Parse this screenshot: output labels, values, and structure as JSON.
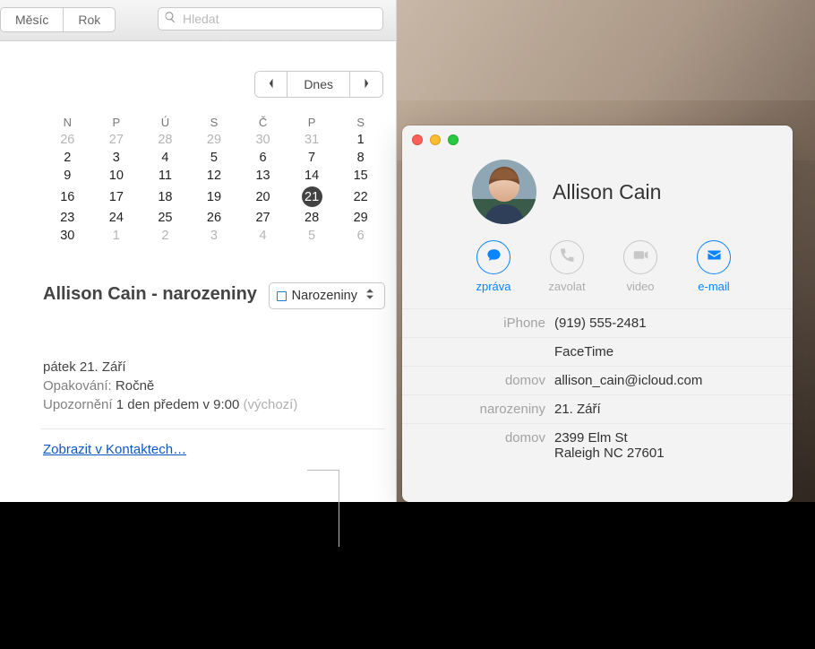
{
  "toolbar": {
    "seg_month": "Měsíc",
    "seg_year": "Rok",
    "search_placeholder": "Hledat",
    "today": "Dnes"
  },
  "mini_cal": {
    "dow": [
      "N",
      "P",
      "Ú",
      "S",
      "Č",
      "P",
      "S"
    ],
    "rows": [
      [
        {
          "d": "26",
          "dim": true
        },
        {
          "d": "27",
          "dim": true
        },
        {
          "d": "28",
          "dim": true
        },
        {
          "d": "29",
          "dim": true
        },
        {
          "d": "30",
          "dim": true
        },
        {
          "d": "31",
          "dim": true
        },
        {
          "d": "1"
        }
      ],
      [
        {
          "d": "2"
        },
        {
          "d": "3"
        },
        {
          "d": "4"
        },
        {
          "d": "5"
        },
        {
          "d": "6"
        },
        {
          "d": "7"
        },
        {
          "d": "8"
        }
      ],
      [
        {
          "d": "9"
        },
        {
          "d": "10"
        },
        {
          "d": "11"
        },
        {
          "d": "12"
        },
        {
          "d": "13"
        },
        {
          "d": "14"
        },
        {
          "d": "15"
        }
      ],
      [
        {
          "d": "16"
        },
        {
          "d": "17"
        },
        {
          "d": "18"
        },
        {
          "d": "19"
        },
        {
          "d": "20"
        },
        {
          "d": "21",
          "sel": true
        },
        {
          "d": "22"
        }
      ],
      [
        {
          "d": "23"
        },
        {
          "d": "24"
        },
        {
          "d": "25"
        },
        {
          "d": "26"
        },
        {
          "d": "27"
        },
        {
          "d": "28"
        },
        {
          "d": "29"
        }
      ],
      [
        {
          "d": "30"
        },
        {
          "d": "1",
          "dim": true
        },
        {
          "d": "2",
          "dim": true
        },
        {
          "d": "3",
          "dim": true
        },
        {
          "d": "4",
          "dim": true
        },
        {
          "d": "5",
          "dim": true
        },
        {
          "d": "6",
          "dim": true
        }
      ]
    ]
  },
  "event": {
    "title": "Allison Cain - narozeniny",
    "category": "Narozeniny",
    "date": "pátek 21. Září",
    "repeat_label": "Opakování:",
    "repeat_value": "Ročně",
    "alert_label": "Upozornění",
    "alert_value": "1 den předem v 9:00",
    "alert_default": "(výchozí)",
    "link": "Zobrazit v Kontaktech…"
  },
  "contact": {
    "name": "Allison Cain",
    "actions": {
      "message": "zpráva",
      "call": "zavolat",
      "video": "video",
      "email": "e-mail"
    },
    "rows": [
      {
        "label": "iPhone",
        "value": "(919) 555-2481"
      },
      {
        "label": "",
        "value": "FaceTime"
      },
      {
        "label": "domov",
        "value": "allison_cain@icloud.com"
      },
      {
        "label": "narozeniny",
        "value": "21. Září"
      },
      {
        "label": "domov",
        "value": "2399 Elm St\nRaleigh NC 27601"
      }
    ]
  }
}
